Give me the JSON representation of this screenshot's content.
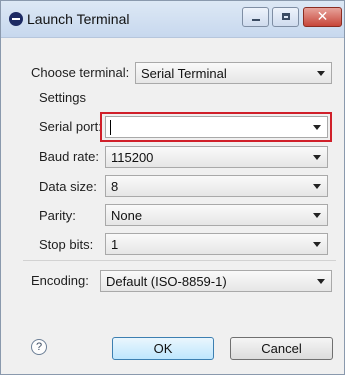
{
  "window": {
    "title": "Launch Terminal"
  },
  "titlebar_buttons": {
    "minimize": "–",
    "maximize": "□",
    "close": "✕"
  },
  "form": {
    "choose_terminal": {
      "label": "Choose terminal:",
      "value": "Serial Terminal"
    },
    "settings_heading": "Settings",
    "serial_port": {
      "label": "Serial port:",
      "value": ""
    },
    "baud_rate": {
      "label": "Baud rate:",
      "value": "115200"
    },
    "data_size": {
      "label": "Data size:",
      "value": "8"
    },
    "parity": {
      "label": "Parity:",
      "value": "None"
    },
    "stop_bits": {
      "label": "Stop bits:",
      "value": "1"
    },
    "encoding": {
      "label": "Encoding:",
      "value": "Default (ISO-8859-1)"
    }
  },
  "footer": {
    "help": "?",
    "ok": "OK",
    "cancel": "Cancel"
  },
  "colors": {
    "highlight": "#d0202a",
    "ok_button": "#bee6fd",
    "title_bar": "#c7d8ee"
  }
}
